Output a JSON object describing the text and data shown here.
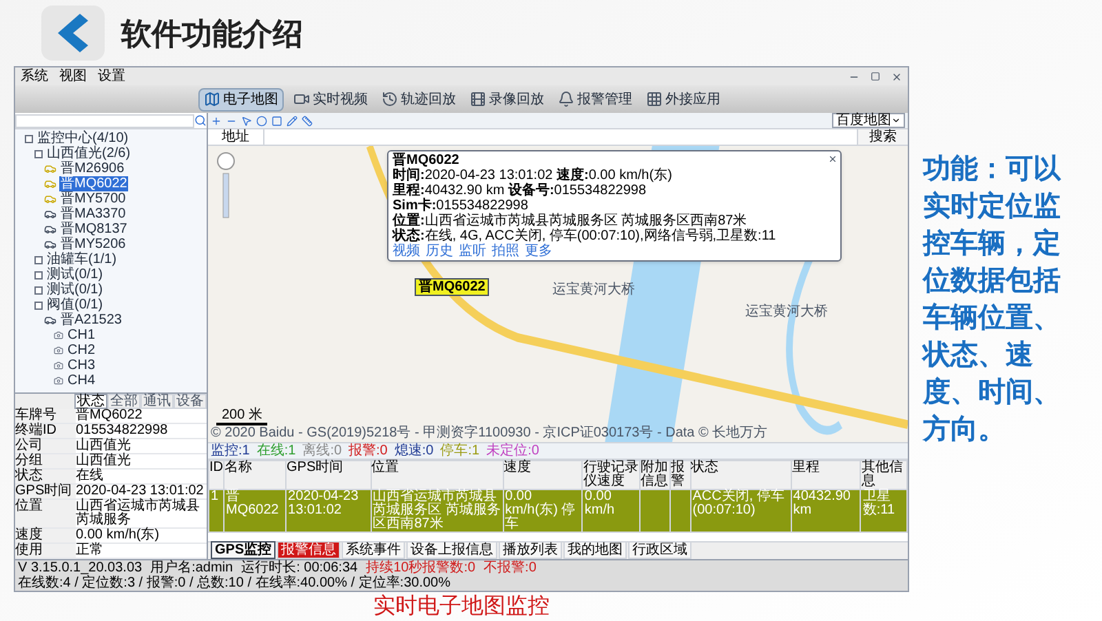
{
  "slide": {
    "title": "软件功能介绍",
    "side_text": "功能：可以实时定位监控车辆，定位数据包括车辆位置、状态、速度、时间、方向。",
    "caption": "实时电子地图监控"
  },
  "app": {
    "menu": [
      "系统",
      "视图",
      "设置"
    ],
    "nav": [
      {
        "label": "电子地图",
        "selected": true
      },
      {
        "label": "实时视频",
        "selected": false
      },
      {
        "label": "轨迹回放",
        "selected": false
      },
      {
        "label": "录像回放",
        "selected": false
      },
      {
        "label": "报警管理",
        "selected": false
      },
      {
        "label": "外接应用",
        "selected": false
      }
    ],
    "map_type": "百度地图",
    "tree": [
      {
        "kind": "group",
        "label": "监控中心(4/10)",
        "selected": false,
        "children": [
          {
            "kind": "group",
            "label": "山西值光(2/6)",
            "selected": false,
            "children": [
              {
                "kind": "vehicle",
                "label": "晋M26906",
                "online": true,
                "selected": false
              },
              {
                "kind": "vehicle",
                "label": "晋MQ6022",
                "online": true,
                "selected": true
              },
              {
                "kind": "vehicle",
                "label": "晋MY5700",
                "online": true,
                "selected": false
              },
              {
                "kind": "vehicle",
                "label": "晋MA3370",
                "online": false,
                "selected": false
              },
              {
                "kind": "vehicle",
                "label": "晋MQ8137",
                "online": false,
                "selected": false
              },
              {
                "kind": "vehicle",
                "label": "晋MY5206",
                "online": false,
                "selected": false
              }
            ]
          },
          {
            "kind": "group",
            "label": "油罐车(1/1)",
            "selected": false
          },
          {
            "kind": "group",
            "label": "测试(0/1)",
            "selected": false
          },
          {
            "kind": "group",
            "label": "测试(0/1)",
            "selected": false
          },
          {
            "kind": "group",
            "label": "阀值(0/1)",
            "selected": false,
            "children": [
              {
                "kind": "vehicle",
                "label": "晋A21523",
                "online": false,
                "selected": false,
                "children": [
                  {
                    "kind": "channel",
                    "label": "CH1",
                    "selected": false
                  },
                  {
                    "kind": "channel",
                    "label": "CH2",
                    "selected": false
                  },
                  {
                    "kind": "channel",
                    "label": "CH3",
                    "selected": false
                  },
                  {
                    "kind": "channel",
                    "label": "CH4",
                    "selected": false
                  }
                ]
              }
            ]
          }
        ]
      }
    ],
    "properties": {
      "tabs": [
        {
          "label": "状态",
          "selected": true
        },
        {
          "label": "全部",
          "selected": false
        },
        {
          "label": "通讯",
          "selected": false
        },
        {
          "label": "设备",
          "selected": false
        }
      ],
      "rows": [
        {
          "label": "车牌号",
          "value": "晋MQ6022"
        },
        {
          "label": "终端ID",
          "value": "015534822998"
        },
        {
          "label": "公司",
          "value": "山西值光"
        },
        {
          "label": "分组",
          "value": "山西值光"
        },
        {
          "label": "状态",
          "value": "在线"
        },
        {
          "label": "GPS时间",
          "value": "2020-04-23 13:01:02"
        },
        {
          "label": "位置",
          "value": "山西省运城市芮城县芮城服务"
        },
        {
          "label": "速度",
          "value": "0.00 km/h(东)"
        },
        {
          "label": "使用",
          "value": "正常"
        }
      ]
    },
    "map": {
      "address_label": "地址",
      "search_button": "搜索",
      "vehicle_label": "晋MQ6022",
      "road_labels": [
        "运宝黄河大桥",
        "运宝黄河大桥"
      ],
      "scale": "200 米",
      "copyright": "© 2020 Baidu - GS(2019)5218号 - 甲测资字1100930 - 京ICP证030173号 - Data © 长地万方",
      "popup": {
        "title": "晋MQ6022",
        "lines": [
          "**时间:**2020-04-23 13:01:02 **速度:**0.00 km/h(东)",
          "**里程:**40432.90 km **设备号:**015534822998",
          "**Sim卡:**015534822998",
          "**位置:**山西省运城市芮城县芮城服务区 芮城服务区西南87米",
          "**状态:**在线, 4G, ACC关闭, 停车(00:07:10),网络信号弱,卫星数:11"
        ],
        "links": [
          "视频",
          "历史",
          "监听",
          "拍照",
          "更多"
        ]
      }
    },
    "legend": [
      {
        "label": "监控:1",
        "color": "#1f3a93"
      },
      {
        "label": "在线:1",
        "color": "#2e9e2e"
      },
      {
        "label": "离线:0",
        "color": "#888888"
      },
      {
        "label": "报警:0",
        "color": "#d01818"
      },
      {
        "label": "熄速:0",
        "color": "#1f3a93"
      },
      {
        "label": "停车:1",
        "color": "#9a9a10"
      },
      {
        "label": "未定位:0",
        "color": "#c040c0"
      }
    ],
    "table": {
      "columns": [
        "ID",
        "名称",
        "GPS时间",
        "位置",
        "速度",
        "行驶记录仪速度",
        "附加信息",
        "报警",
        "状态",
        "里程",
        "其他信息"
      ],
      "rows": [
        {
          "selected": true,
          "cells": [
            "1",
            "晋MQ6022",
            "2020-04-23 13:01:02",
            "山西省运城市芮城县芮城服务区 芮城服务区西南87米",
            "0.00 km/h(东) 停车",
            "0.00 km/h",
            "",
            "",
            "ACC关闭, 停车(00:07:10)",
            "40432.90 km",
            "卫星数:11"
          ]
        }
      ]
    },
    "bottom_tabs": [
      {
        "label": "GPS监控",
        "selected": true,
        "alert": false
      },
      {
        "label": "报警信息",
        "selected": false,
        "alert": true
      },
      {
        "label": "系统事件",
        "selected": false,
        "alert": false
      },
      {
        "label": "设备上报信息",
        "selected": false,
        "alert": false
      },
      {
        "label": "播放列表",
        "selected": false,
        "alert": false
      },
      {
        "label": "我的地图",
        "selected": false,
        "alert": false
      },
      {
        "label": "行政区域",
        "selected": false,
        "alert": false
      }
    ],
    "status": {
      "version": "V 3.15.0.1_20.03.03",
      "user": "用户名:admin",
      "items": [
        {
          "text": "运行时长: 00:06:34",
          "alert": false
        },
        {
          "text": "持续10秒报警数:0",
          "alert": true
        },
        {
          "text": "不报警:0",
          "alert": true
        },
        {
          "text": "在线数:4 / 定位数:3 / 报警:0 / 总数:10 / 在线率:40.00% / 定位率:30.00%",
          "alert": false
        }
      ]
    }
  }
}
